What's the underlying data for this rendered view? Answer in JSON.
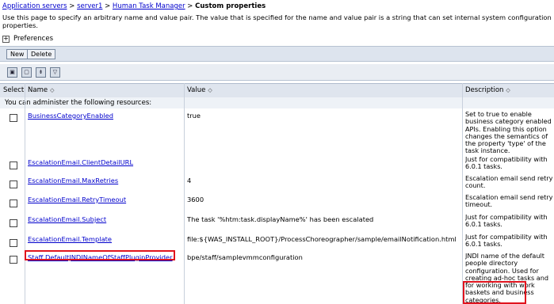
{
  "breadcrumb": {
    "link1": "Application servers",
    "link2": "server1",
    "link3": "Human Task Manager",
    "current": "Custom properties",
    "sep": " > "
  },
  "description": "Use this page to specify an arbitrary name and value pair. The value that is specified for the name and value pair is a string that can set internal system configuration properties.",
  "preferences": {
    "label": "Preferences",
    "icon": "plus-icon"
  },
  "toolbar": {
    "new_label": "New",
    "delete_label": "Delete"
  },
  "table": {
    "headers": {
      "select": "Select",
      "name": "Name",
      "value": "Value",
      "description": "Description"
    },
    "admin_text": "You can administer the following resources:",
    "rows": [
      {
        "name": "BusinessCategoryEnabled",
        "value": "true",
        "description": "Set to true to enable business category enabled APIs. Enabling this option changes the semantics of the property 'type' of the task instance."
      },
      {
        "name": "EscalationEmail.ClientDetailURL",
        "value": "",
        "description": "Just for compatibility with 6.0.1 tasks."
      },
      {
        "name": "EscalationEmail.MaxRetries",
        "value": "4",
        "description": "Escalation email send retry count."
      },
      {
        "name": "EscalationEmail.RetryTimeout",
        "value": "3600",
        "description": "Escalation email send retry timeout."
      },
      {
        "name": "EscalationEmail.Subject",
        "value": "The task '%htm:task.displayName%' has been escalated",
        "description": "Just for compatibility with 6.0.1 tasks."
      },
      {
        "name": "EscalationEmail.Template",
        "value": "file:${WAS_INSTALL_ROOT}/ProcessChoreographer/sample/emailNotification.html",
        "description": "Just for compatibility with 6.0.1 tasks."
      },
      {
        "name": "Staff.DefaultJNDINameOfStaffPluginProvider",
        "value": "bpe/staff/samplevmmconfiguration",
        "description": "JNDI name of the default people directory configuration. Used for creating ad-hoc tasks and for working with work baskets and business categories."
      }
    ]
  },
  "colors": {
    "link": "#0000cc",
    "highlight": "#e0141e",
    "header_bg": "#dfe5ee"
  }
}
